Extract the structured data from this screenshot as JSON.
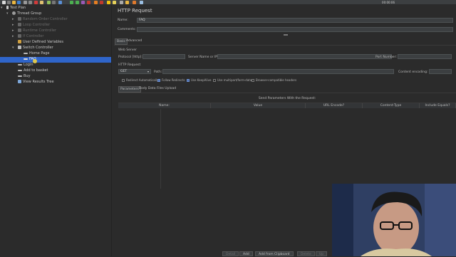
{
  "toolbar": {
    "clock": "00:00:06"
  },
  "tree": {
    "nodes": [
      {
        "label": "Test Plan"
      },
      {
        "label": "Thread Group"
      },
      {
        "label": "Random Order Controller"
      },
      {
        "label": "Loop Controller"
      },
      {
        "label": "Runtime Controller"
      },
      {
        "label": "If Controller"
      },
      {
        "label": "User Defined Variables"
      },
      {
        "label": "Switch Controller"
      },
      {
        "label": "Home Page"
      },
      {
        "label": "FAQ"
      },
      {
        "label": "Login"
      },
      {
        "label": "Add to basket"
      },
      {
        "label": "Buy"
      },
      {
        "label": "View Results Tree"
      }
    ]
  },
  "main": {
    "title": "HTTP Request",
    "name_label": "Name:",
    "name_value": "FAQ",
    "comments_label": "Comments:",
    "tabs": {
      "basic": "Basic",
      "advanced": "Advanced"
    },
    "web_server": "Web Server",
    "protocol_label": "Protocol [http]:",
    "server_label": "Server Name or IP:",
    "port_label": "Port Number:",
    "http_request": "HTTP Request",
    "method": "GET",
    "path_label": "Path:",
    "encoding_label": "Content encoding:",
    "checks": {
      "redirect_auto": "Redirect Automatically",
      "follow_redirects": "Follow Redirects",
      "keepalive": "Use KeepAlive",
      "multipart": "Use multipart/form-data",
      "browser_headers": "Browser-compatible headers"
    },
    "subtabs": {
      "parameters": "Parameters",
      "body": "Body Data",
      "files": "Files Upload"
    },
    "grid_title": "Send Parameters With the Request:",
    "columns": {
      "name": "Name:",
      "value": "Value",
      "encode": "URL Encode?",
      "ctype": "Content-Type",
      "include": "Include Equals?"
    },
    "buttons": {
      "detail": "Detail",
      "add": "Add",
      "clipboard": "Add from Clipboard",
      "delete": "Delete",
      "up": "Up"
    }
  }
}
